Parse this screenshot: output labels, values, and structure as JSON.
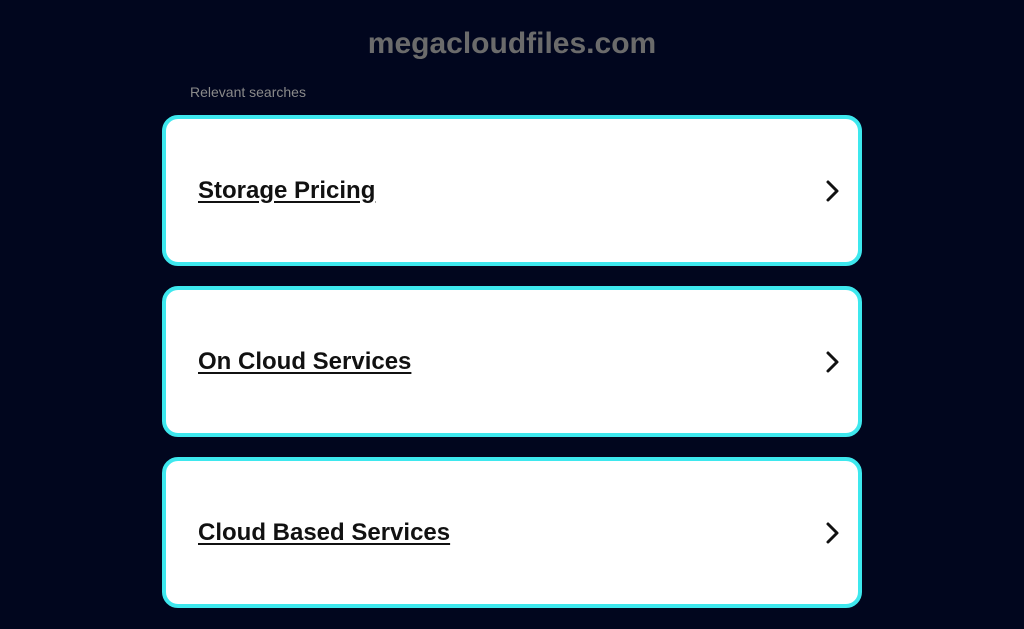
{
  "site": {
    "title": "megacloudfiles.com"
  },
  "section": {
    "label": "Relevant searches"
  },
  "results": [
    {
      "label": "Storage Pricing"
    },
    {
      "label": "On Cloud Services"
    },
    {
      "label": "Cloud Based Services"
    }
  ],
  "colors": {
    "background": "#01061e",
    "card_border": "#3ee8ee",
    "card_background": "#ffffff",
    "title_text": "#6b6b6b"
  },
  "icons": {
    "result_arrow": "chevron-right-icon"
  }
}
